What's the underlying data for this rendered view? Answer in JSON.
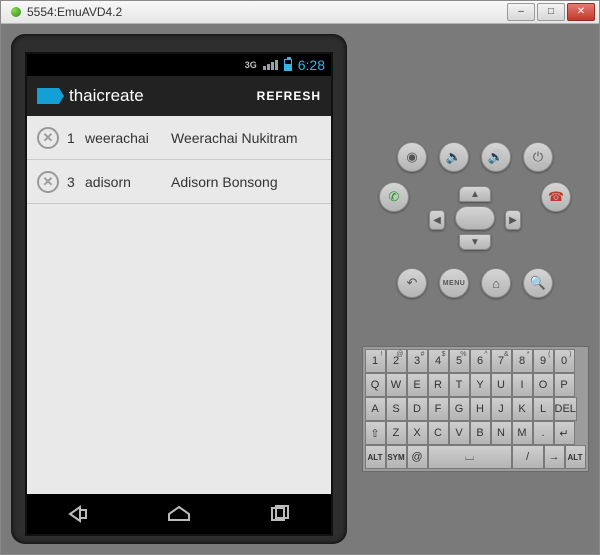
{
  "window": {
    "title": "5554:EmuAVD4.2"
  },
  "statusbar": {
    "net": "3G",
    "time": "6:28"
  },
  "appbar": {
    "title": "thaicreate",
    "action": "REFRESH"
  },
  "rows": [
    {
      "id": "1",
      "user": "weerachai",
      "name": "Weerachai Nukitram"
    },
    {
      "id": "3",
      "user": "adisorn",
      "name": "Adisorn Bonsong"
    }
  ],
  "side": {
    "row1": [
      "camera",
      "vol-down",
      "vol-up",
      "power"
    ],
    "row3": [
      "back",
      "menu",
      "home",
      "search"
    ],
    "menu_label": "MENU"
  },
  "keyboard": {
    "r1": [
      {
        "m": "1",
        "s": "!"
      },
      {
        "m": "2",
        "s": "@"
      },
      {
        "m": "3",
        "s": "#"
      },
      {
        "m": "4",
        "s": "$"
      },
      {
        "m": "5",
        "s": "%"
      },
      {
        "m": "6",
        "s": "^"
      },
      {
        "m": "7",
        "s": "&"
      },
      {
        "m": "8",
        "s": "*"
      },
      {
        "m": "9",
        "s": "("
      },
      {
        "m": "0",
        "s": ")"
      }
    ],
    "r2": [
      {
        "m": "Q"
      },
      {
        "m": "W"
      },
      {
        "m": "E"
      },
      {
        "m": "R"
      },
      {
        "m": "T"
      },
      {
        "m": "Y"
      },
      {
        "m": "U"
      },
      {
        "m": "I"
      },
      {
        "m": "O"
      },
      {
        "m": "P"
      }
    ],
    "r3": [
      {
        "m": "A"
      },
      {
        "m": "S"
      },
      {
        "m": "D"
      },
      {
        "m": "F"
      },
      {
        "m": "G"
      },
      {
        "m": "H"
      },
      {
        "m": "J"
      },
      {
        "m": "K"
      },
      {
        "m": "L"
      },
      {
        "m": "DEL",
        "s": ""
      }
    ],
    "r4": [
      {
        "m": "⇧"
      },
      {
        "m": "Z"
      },
      {
        "m": "X"
      },
      {
        "m": "C"
      },
      {
        "m": "V"
      },
      {
        "m": "B"
      },
      {
        "m": "N"
      },
      {
        "m": "M"
      },
      {
        "m": "."
      },
      {
        "m": "↵"
      }
    ],
    "r5_left": [
      {
        "m": "ALT"
      },
      {
        "m": "SYM"
      },
      {
        "m": "@"
      }
    ],
    "r5_right": [
      {
        "m": "→"
      },
      {
        "m": "ALT"
      }
    ],
    "space": "␣"
  }
}
